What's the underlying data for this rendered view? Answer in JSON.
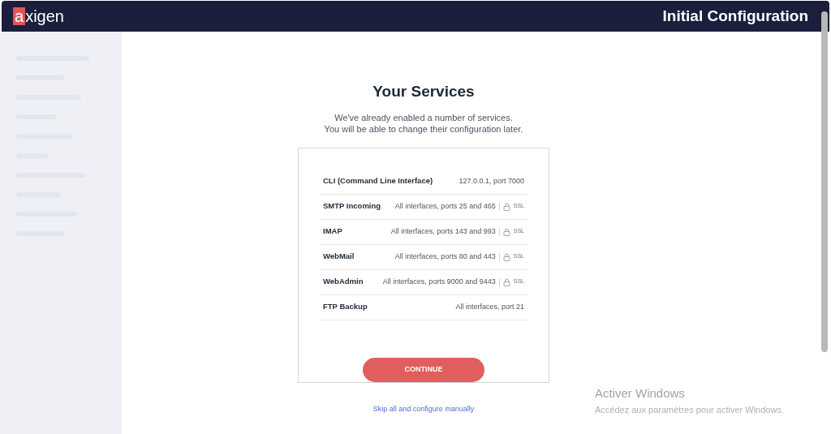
{
  "header": {
    "logo": {
      "mark": "a",
      "rest": "xigen"
    },
    "title": "Initial Configuration"
  },
  "dialog": {
    "title": "Your Services",
    "subtitle_lines": [
      "We've already enabled a number of services.",
      "You will be able to change their configuration later."
    ],
    "services": [
      {
        "name": "CLI (Command Line Interface)",
        "detail": "127.0.0.1, port 7000"
      },
      {
        "name": "SMTP Incoming",
        "detail": "All interfaces, ports 25 and 465",
        "badge": "SSL"
      },
      {
        "name": "IMAP",
        "detail": "All interfaces, ports 143 and 993",
        "badge": "SSL"
      },
      {
        "name": "WebMail",
        "detail": "All interfaces, ports 80 and 443",
        "badge": "SSL"
      },
      {
        "name": "WebAdmin",
        "detail": "All interfaces, ports 9000 and 9443",
        "badge": "SSL"
      },
      {
        "name": "FTP Backup",
        "detail": "All interfaces, port 21"
      }
    ],
    "continue_button": "CONTINUE",
    "skip_link": "Skip all and configure manually"
  },
  "windows_activation": {
    "title": "Activer Windows",
    "message": "Accédez aux paramètres pour activer Windows."
  }
}
